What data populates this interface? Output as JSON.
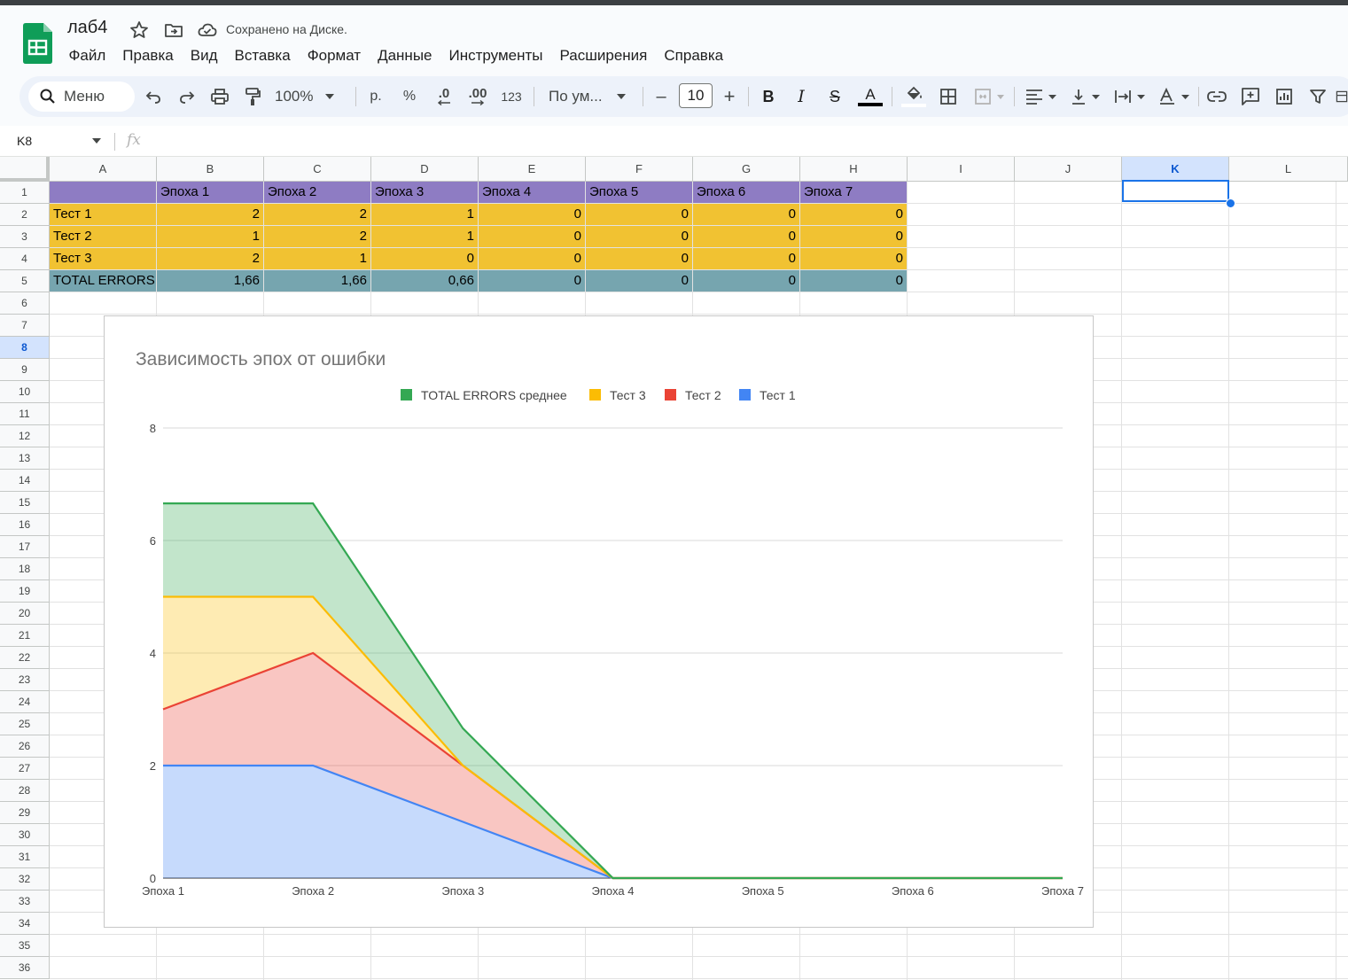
{
  "app": {
    "doc_title": "лаб4",
    "saved_status": "Сохранено на Диске."
  },
  "menu": [
    "Файл",
    "Правка",
    "Вид",
    "Вставка",
    "Формат",
    "Данные",
    "Инструменты",
    "Расширения",
    "Справка"
  ],
  "toolbar": {
    "search_label": "Меню",
    "zoom": "100%",
    "currency": "р.",
    "percent": "%",
    "dec_decrease": ".0",
    "dec_increase": ".00",
    "number_format": "123",
    "font": "По ум...",
    "font_size": "10",
    "minus": "–",
    "plus": "+",
    "bold": "B",
    "italic": "I",
    "strike": "S",
    "text_color": "A"
  },
  "formula_bar": {
    "cell_ref": "K8",
    "fx_label": "fx"
  },
  "sheet": {
    "columns": [
      "A",
      "B",
      "C",
      "D",
      "E",
      "F",
      "G",
      "H",
      "I",
      "J",
      "K",
      "L"
    ],
    "selected_column": "K",
    "selected_row": 8,
    "rows": [
      [
        "",
        "Эпоха 1",
        "Эпоха 2",
        "Эпоха 3",
        "Эпоха 4",
        "Эпоха 5",
        "Эпоха 6",
        "Эпоха 7"
      ],
      [
        "Тест 1",
        "2",
        "2",
        "1",
        "0",
        "0",
        "0",
        "0"
      ],
      [
        "Тест 2",
        "1",
        "2",
        "1",
        "0",
        "0",
        "0",
        "0"
      ],
      [
        "Тест 3",
        "2",
        "1",
        "0",
        "0",
        "0",
        "0",
        "0"
      ],
      [
        "TOTAL ERRORS",
        "1,66",
        "1,66",
        "0,66",
        "0",
        "0",
        "0",
        "0"
      ]
    ],
    "row_colors": [
      "#8e7cc3",
      "#f1c232",
      "#f1c232",
      "#f1c232",
      "#76a5af"
    ]
  },
  "chart_data": {
    "type": "area",
    "stacked": true,
    "title": "Зависимость эпох от ошибки",
    "categories": [
      "Эпоха 1",
      "Эпоха 2",
      "Эпоха 3",
      "Эпоха 4",
      "Эпоха 5",
      "Эпоха 6",
      "Эпоха 7"
    ],
    "series": [
      {
        "name": "Тест 1",
        "values": [
          2,
          2,
          1,
          0,
          0,
          0,
          0
        ],
        "color": "#4285f4"
      },
      {
        "name": "Тест 2",
        "values": [
          1,
          2,
          1,
          0,
          0,
          0,
          0
        ],
        "color": "#ea4335"
      },
      {
        "name": "Тест 3",
        "values": [
          2,
          1,
          0,
          0,
          0,
          0,
          0
        ],
        "color": "#fbbc04"
      },
      {
        "name": "TOTAL ERRORS среднее",
        "values": [
          1.66,
          1.66,
          0.66,
          0,
          0,
          0,
          0
        ],
        "color": "#34a853"
      }
    ],
    "legend_order": [
      "TOTAL ERRORS среднее",
      "Тест 3",
      "Тест 2",
      "Тест 1"
    ],
    "legend_position": "top",
    "yticks": [
      "0",
      "2",
      "4",
      "6",
      "8"
    ],
    "ylim": [
      0,
      8
    ],
    "grid": true
  }
}
